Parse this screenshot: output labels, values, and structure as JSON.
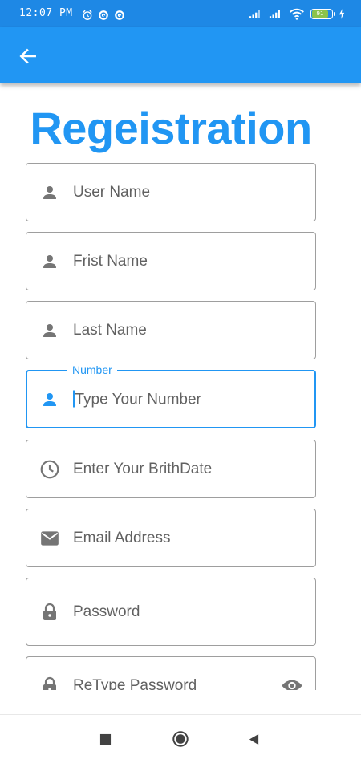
{
  "status_bar": {
    "time": "12:07 PM",
    "battery": "91"
  },
  "app_bar": {
    "back_icon": "arrow-left-icon"
  },
  "page": {
    "title": "Regeistration"
  },
  "fields": {
    "user_name": {
      "placeholder": "User Name",
      "icon": "person-icon"
    },
    "first_name": {
      "placeholder": "Frist Name",
      "icon": "person-icon"
    },
    "last_name": {
      "placeholder": "Last Name",
      "icon": "person-icon"
    },
    "number": {
      "label": "Number",
      "placeholder": "Type Your Number",
      "icon": "person-icon"
    },
    "birthdate": {
      "placeholder": "Enter Your BrithDate",
      "icon": "clock-icon"
    },
    "email": {
      "placeholder": "Email Address",
      "icon": "mail-icon"
    },
    "password": {
      "placeholder": "Password",
      "icon": "lock-icon"
    },
    "retype_password": {
      "placeholder": "ReType Password",
      "icon": "lock-icon",
      "toggle_icon": "eye-icon"
    }
  },
  "colors": {
    "primary": "#2196F3",
    "status_bar": "#1E88E5",
    "field_border": "#9E9E9E",
    "icon_gray": "#757575",
    "text_gray": "#616161",
    "battery_green": "#8BC34A"
  }
}
